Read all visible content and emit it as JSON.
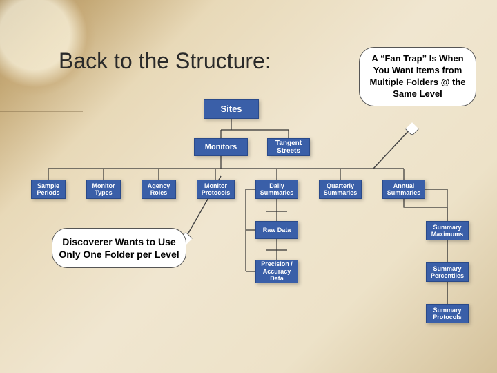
{
  "title": "Back to the Structure:",
  "callouts": {
    "fan_trap": "A “Fan Trap” Is When You Want Items from Multiple Folders @ the Same Level",
    "discoverer": "Discoverer Wants to Use Only One Folder per Level"
  },
  "chart_data": {
    "type": "tree",
    "nodes": {
      "sites": "Sites",
      "monitors": "Monitors",
      "tangent_streets": "Tangent Streets",
      "sample_periods": "Sample Periods",
      "monitor_types": "Monitor Types",
      "agency_roles": "Agency Roles",
      "monitor_protocols": "Monitor Protocols",
      "daily_summaries": "Daily Summaries",
      "quarterly_summaries": "Quarterly Summaries",
      "annual_summaries": "Annual Summaries",
      "raw_data": "Raw Data",
      "precision_accuracy": "Precision / Accuracy Data",
      "summary_maximums": "Summary Maximums",
      "summary_percentiles": "Summary Percentiles",
      "summary_protocols": "Summary Protocols"
    },
    "edges": [
      [
        "sites",
        "monitors"
      ],
      [
        "sites",
        "tangent_streets"
      ],
      [
        "monitors",
        "sample_periods"
      ],
      [
        "monitors",
        "monitor_types"
      ],
      [
        "monitors",
        "agency_roles"
      ],
      [
        "monitors",
        "monitor_protocols"
      ],
      [
        "monitors",
        "daily_summaries"
      ],
      [
        "monitors",
        "quarterly_summaries"
      ],
      [
        "monitors",
        "annual_summaries"
      ],
      [
        "daily_summaries",
        "raw_data"
      ],
      [
        "daily_summaries",
        "precision_accuracy"
      ],
      [
        "annual_summaries",
        "summary_maximums"
      ],
      [
        "annual_summaries",
        "summary_percentiles"
      ],
      [
        "annual_summaries",
        "summary_protocols"
      ]
    ]
  },
  "colors": {
    "node_fill": "#3a5fa8",
    "node_text": "#ffffff"
  }
}
